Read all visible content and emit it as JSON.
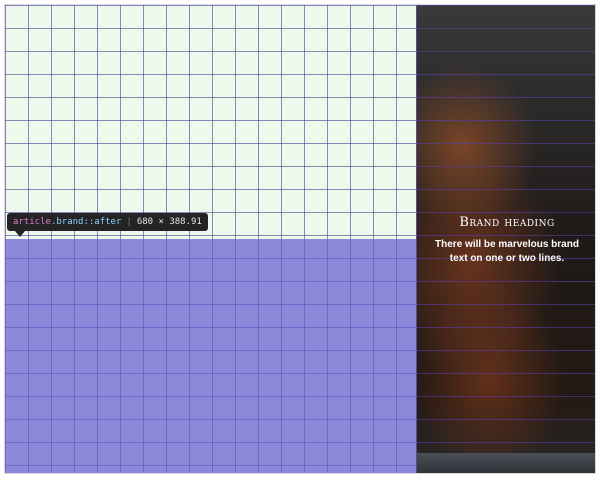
{
  "tooltip": {
    "selector_tag": "article",
    "selector_class": ".brand",
    "selector_pseudo": "::after",
    "dimensions": "680 × 388.91"
  },
  "brand": {
    "heading": "Brand heading",
    "body": "There will be marvelous brand text on one or two lines."
  },
  "colors": {
    "grid_bg": "#eef9ee",
    "grid_line": "#3c288c",
    "overlay": "#645ad2",
    "tooltip_bg": "#242424"
  }
}
